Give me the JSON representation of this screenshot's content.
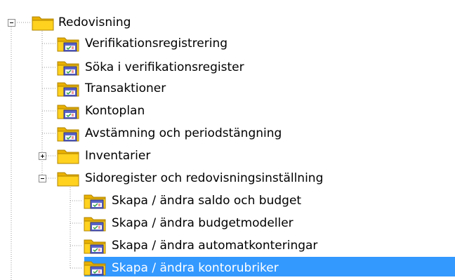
{
  "colors": {
    "selection": "#3399ff",
    "folder_yellow": "#f5c400",
    "guide_line": "#9a9a9a"
  },
  "tree": {
    "root": {
      "label": "Redovisning",
      "icon": "folder-icon",
      "expanded": true
    },
    "items": [
      {
        "label": "Verifikationsregistrering",
        "icon": "module-folder-icon"
      },
      {
        "label": "Söka i verifikationsregister",
        "icon": "module-folder-icon"
      },
      {
        "label": "Transaktioner",
        "icon": "module-folder-icon"
      },
      {
        "label": "Kontoplan",
        "icon": "module-folder-icon"
      },
      {
        "label": "Avstämning och periodstängning",
        "icon": "module-folder-icon"
      },
      {
        "label": "Inventarier",
        "icon": "folder-icon",
        "expanded": false
      },
      {
        "label": "Sidoregister och redovisningsinställning",
        "icon": "folder-icon",
        "expanded": true
      }
    ],
    "sub_items": [
      {
        "label": "Skapa / ändra saldo och budget",
        "icon": "module-folder-icon"
      },
      {
        "label": "Skapa / ändra budgetmodeller",
        "icon": "module-folder-icon"
      },
      {
        "label": "Skapa / ändra automatkonteringar",
        "icon": "module-folder-icon"
      },
      {
        "label": "Skapa / ändra kontorubriker",
        "icon": "module-folder-icon",
        "selected": true
      }
    ]
  }
}
